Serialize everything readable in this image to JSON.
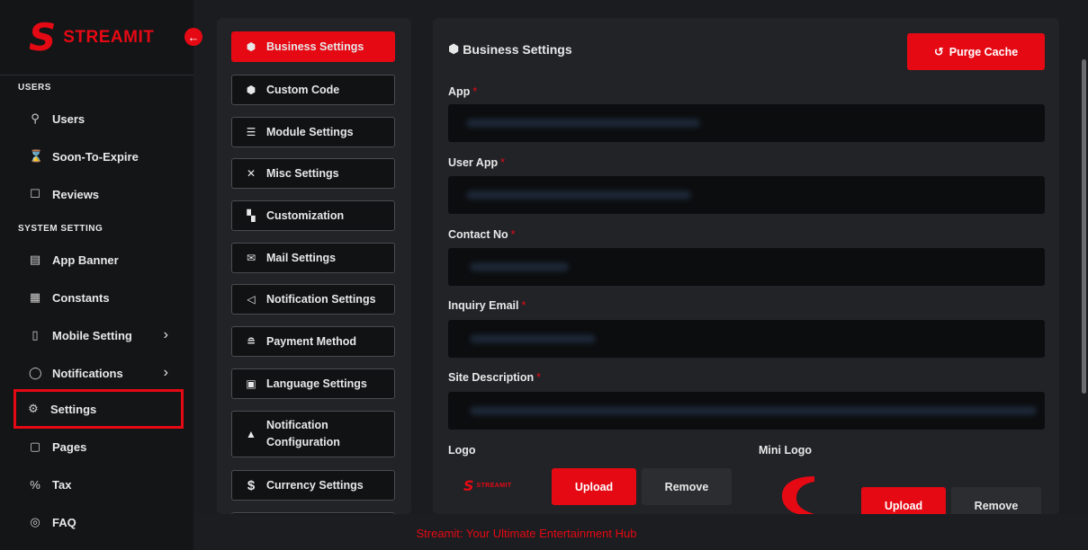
{
  "brand": {
    "mark": "S",
    "name": "STREAMIT"
  },
  "sidebar": {
    "sections": [
      {
        "label": "USERS"
      },
      {
        "label": "SYSTEM SETTING"
      }
    ],
    "items": [
      {
        "label": "Users",
        "icon": "user-icon"
      },
      {
        "label": "Soon-To-Expire",
        "icon": "hourglass-icon"
      },
      {
        "label": "Reviews",
        "icon": "reviews-icon"
      },
      {
        "label": "App Banner",
        "icon": "banner-icon"
      },
      {
        "label": "Constants",
        "icon": "keyboard-icon"
      },
      {
        "label": "Mobile Setting",
        "icon": "mobile-icon"
      },
      {
        "label": "Notifications",
        "icon": "bell-icon"
      },
      {
        "label": "Settings",
        "icon": "gear-icon"
      },
      {
        "label": "Pages",
        "icon": "page-icon"
      },
      {
        "label": "Tax",
        "icon": "percent-icon"
      },
      {
        "label": "FAQ",
        "icon": "question-icon"
      }
    ]
  },
  "settings_menu": [
    {
      "label": "Business Settings",
      "icon": "cube-icon",
      "active": true
    },
    {
      "label": "Custom Code",
      "icon": "cube-icon"
    },
    {
      "label": "Module Settings",
      "icon": "list-icon"
    },
    {
      "label": "Misc Settings",
      "icon": "tools-icon"
    },
    {
      "label": "Customization",
      "icon": "paint-icon"
    },
    {
      "label": "Mail Settings",
      "icon": "envelope-icon"
    },
    {
      "label": "Notification Settings",
      "icon": "megaphone-icon"
    },
    {
      "label": "Payment Method",
      "icon": "coins-icon"
    },
    {
      "label": "Language Settings",
      "icon": "language-icon"
    },
    {
      "label": "Notification Configuration",
      "icon": "bell-icon"
    },
    {
      "label": "Currency Settings",
      "icon": "dollar-icon"
    }
  ],
  "main": {
    "title": "Business Settings",
    "purge_label": "Purge Cache",
    "fields": [
      {
        "label": "App"
      },
      {
        "label": "User App"
      },
      {
        "label": "Contact No"
      },
      {
        "label": "Inquiry Email"
      },
      {
        "label": "Site Description"
      }
    ],
    "required_mark": "*",
    "logo_label": "Logo",
    "mini_logo_label": "Mini Logo",
    "upload_label": "Upload",
    "remove_label": "Remove"
  },
  "footer": {
    "text": "Streamit: Your Ultimate Entertainment Hub"
  },
  "colors": {
    "accent": "#e50914",
    "panel": "#212327",
    "input": "#0c0d0f",
    "sidebar": "#141517"
  }
}
